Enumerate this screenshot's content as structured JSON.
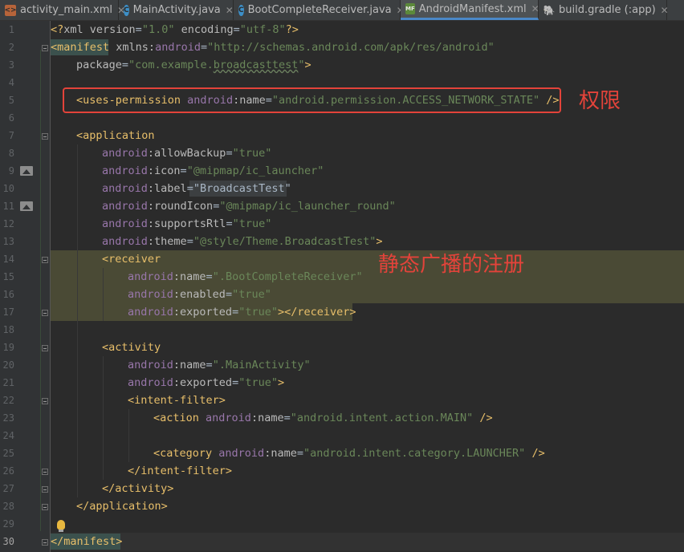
{
  "tabs": [
    {
      "label": "activity_main.xml",
      "icon": "xml-file-icon",
      "active": false
    },
    {
      "label": "MainActivity.java",
      "icon": "java-class-icon",
      "active": false
    },
    {
      "label": "BootCompleteReceiver.java",
      "icon": "java-class-icon",
      "active": false
    },
    {
      "label": "AndroidManifest.xml",
      "icon": "manifest-file-icon",
      "active": true
    },
    {
      "label": "build.gradle (:app)",
      "icon": "gradle-icon",
      "active": false
    }
  ],
  "line_numbers": [
    "1",
    "2",
    "3",
    "4",
    "5",
    "6",
    "7",
    "8",
    "9",
    "10",
    "11",
    "12",
    "13",
    "14",
    "15",
    "16",
    "17",
    "18",
    "19",
    "20",
    "21",
    "22",
    "23",
    "24",
    "25",
    "26",
    "27",
    "28",
    "29",
    "30"
  ],
  "code": {
    "l1": {
      "a": "<?",
      "b": "xml version",
      "c": "=",
      "d": "\"1.0\"",
      "e": " encoding",
      "f": "=",
      "g": "\"utf-8\"",
      "h": "?>"
    },
    "l2": {
      "a": "<manifest",
      "b": " xmlns:",
      "c": "android",
      "d": "=",
      "e": "\"http://schemas.android.com/apk/res/android\""
    },
    "l3": {
      "a": "package",
      "b": "=",
      "c": "\"com.example.",
      "d": "broadcasttest",
      "e": "\"",
      "f": ">"
    },
    "l5": {
      "a": "<uses-permission",
      "b": " android",
      "c": ":name",
      "d": "=",
      "e": "\"android.permission.ACCESS_NETWORK_STATE\"",
      "f": " />"
    },
    "l7": {
      "a": "<application"
    },
    "l8": {
      "a": "android",
      "b": ":allowBackup",
      "c": "=",
      "d": "\"true\""
    },
    "l9": {
      "a": "android",
      "b": ":icon",
      "c": "=",
      "d": "\"@mipmap/ic_launcher\""
    },
    "l10": {
      "a": "android",
      "b": ":label",
      "c": "=",
      "d": "\"BroadcastTest\""
    },
    "l11": {
      "a": "android",
      "b": ":roundIcon",
      "c": "=",
      "d": "\"@mipmap/ic_launcher_round\""
    },
    "l12": {
      "a": "android",
      "b": ":supportsRtl",
      "c": "=",
      "d": "\"true\""
    },
    "l13": {
      "a": "android",
      "b": ":theme",
      "c": "=",
      "d": "\"@style/Theme.BroadcastTest\"",
      "e": ">"
    },
    "l14": {
      "a": "<receiver"
    },
    "l15": {
      "a": "android",
      "b": ":name",
      "c": "=",
      "d": "\".BootCompleteReceiver\""
    },
    "l16": {
      "a": "android",
      "b": ":enabled",
      "c": "=",
      "d": "\"true\""
    },
    "l17": {
      "a": "android",
      "b": ":exported",
      "c": "=",
      "d": "\"true\"",
      "e": "></receiver>"
    },
    "l19": {
      "a": "<activity"
    },
    "l20": {
      "a": "android",
      "b": ":name",
      "c": "=",
      "d": "\".MainActivity\""
    },
    "l21": {
      "a": "android",
      "b": ":exported",
      "c": "=",
      "d": "\"true\"",
      "e": ">"
    },
    "l22": {
      "a": "<intent-filter>"
    },
    "l23": {
      "a": "<action",
      "b": " android",
      "c": ":name",
      "d": "=",
      "e": "\"android.intent.action.MAIN\"",
      "f": " />"
    },
    "l25": {
      "a": "<category",
      "b": " android",
      "c": ":name",
      "d": "=",
      "e": "\"android.intent.category.LAUNCHER\"",
      "f": " />"
    },
    "l26": {
      "a": "</intent-filter>"
    },
    "l27": {
      "a": "</activity>"
    },
    "l28": {
      "a": "</application>"
    },
    "l30": {
      "a": "</manifest>"
    }
  },
  "annotations": {
    "permission": "权限",
    "static_registration": "静态广播的注册"
  },
  "colors": {
    "annotation": "#e3433a",
    "tag": "#e8bf6a",
    "string": "#6a8759",
    "namespace": "#9876aa",
    "background": "#2b2b2b"
  }
}
